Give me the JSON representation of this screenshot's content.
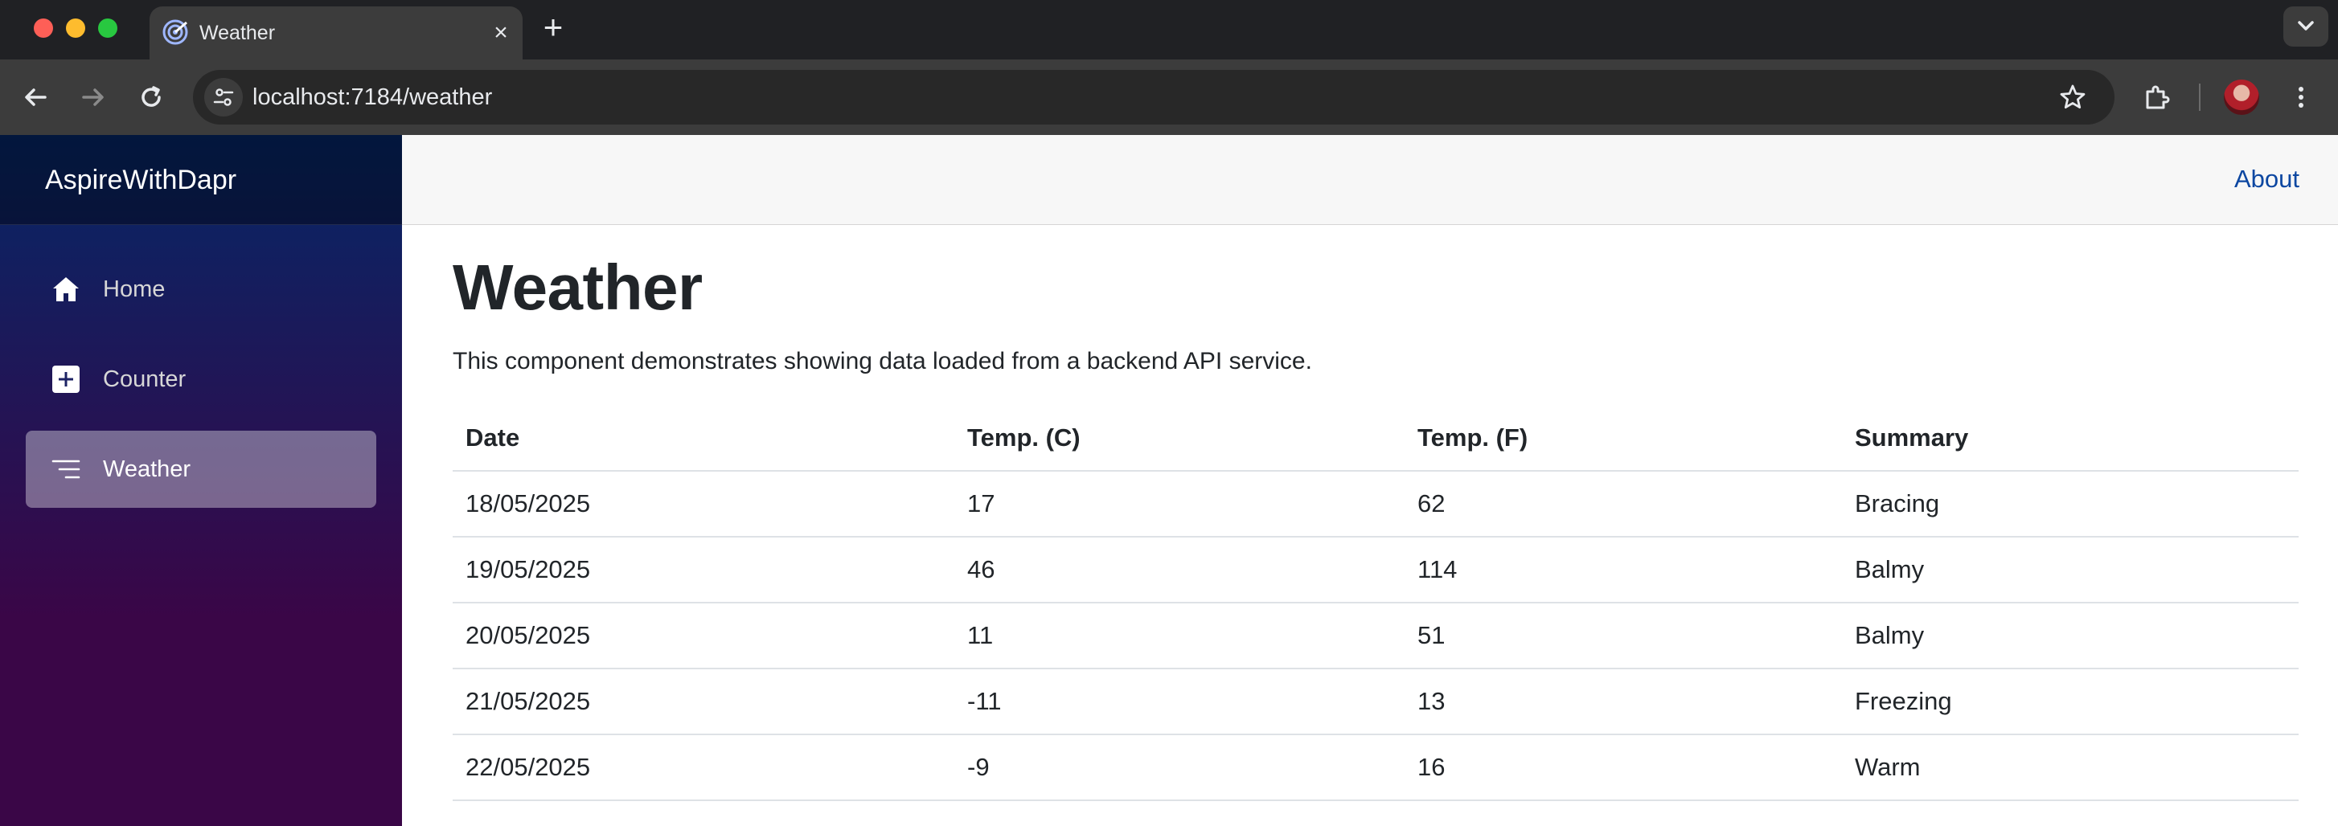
{
  "browser": {
    "tab_title": "Weather",
    "url": "localhost:7184/weather"
  },
  "sidebar": {
    "brand": "AspireWithDapr",
    "items": [
      {
        "label": "Home",
        "icon": "home-icon",
        "active": false
      },
      {
        "label": "Counter",
        "icon": "plus-square-icon",
        "active": false
      },
      {
        "label": "Weather",
        "icon": "list-icon",
        "active": true
      }
    ]
  },
  "header": {
    "about_label": "About"
  },
  "main": {
    "title": "Weather",
    "description": "This component demonstrates showing data loaded from a backend API service.",
    "table": {
      "columns": [
        "Date",
        "Temp. (C)",
        "Temp. (F)",
        "Summary"
      ],
      "rows": [
        [
          "18/05/2025",
          "17",
          "62",
          "Bracing"
        ],
        [
          "19/05/2025",
          "46",
          "114",
          "Balmy"
        ],
        [
          "20/05/2025",
          "11",
          "51",
          "Balmy"
        ],
        [
          "21/05/2025",
          "-11",
          "13",
          "Freezing"
        ],
        [
          "22/05/2025",
          "-9",
          "16",
          "Warm"
        ]
      ]
    }
  },
  "colors": {
    "sidebar_gradient_top": "#052767",
    "sidebar_gradient_bottom": "#3a0647",
    "link": "#0d47a1",
    "active_nav": "rgba(255,255,255,0.37)"
  }
}
